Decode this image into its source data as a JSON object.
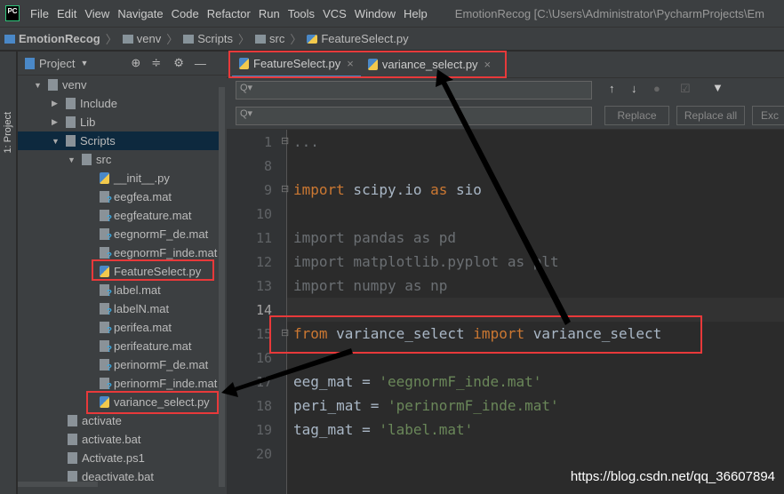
{
  "menubar": {
    "logo": "PC",
    "items": [
      "File",
      "Edit",
      "View",
      "Navigate",
      "Code",
      "Refactor",
      "Run",
      "Tools",
      "VCS",
      "Window",
      "Help"
    ],
    "window_title": "EmotionRecog [C:\\Users\\Administrator\\PycharmProjects\\Em"
  },
  "breadcrumb": [
    "EmotionRecog",
    "venv",
    "Scripts",
    "src",
    "FeatureSelect.py"
  ],
  "tool_strip": {
    "label": "1: Project"
  },
  "sidebar": {
    "title": "Project",
    "tree": [
      {
        "label": "venv",
        "depth": 1,
        "type": "folder",
        "expanded": true
      },
      {
        "label": "Include",
        "depth": 2,
        "type": "folder"
      },
      {
        "label": "Lib",
        "depth": 2,
        "type": "folder",
        "expanded": false
      },
      {
        "label": "Scripts",
        "depth": 2,
        "type": "folder",
        "expanded": true,
        "selected": true
      },
      {
        "label": "src",
        "depth": 3,
        "type": "folder",
        "expanded": true
      },
      {
        "label": "__init__.py",
        "depth": 4,
        "type": "py"
      },
      {
        "label": "eegfea.mat",
        "depth": 4,
        "type": "mat"
      },
      {
        "label": "eegfeature.mat",
        "depth": 4,
        "type": "mat"
      },
      {
        "label": "eegnormF_de.mat",
        "depth": 4,
        "type": "mat"
      },
      {
        "label": "eegnormF_inde.mat",
        "depth": 4,
        "type": "mat"
      },
      {
        "label": "FeatureSelect.py",
        "depth": 4,
        "type": "py"
      },
      {
        "label": "label.mat",
        "depth": 4,
        "type": "mat"
      },
      {
        "label": "labelN.mat",
        "depth": 4,
        "type": "mat"
      },
      {
        "label": "perifea.mat",
        "depth": 4,
        "type": "mat"
      },
      {
        "label": "perifeature.mat",
        "depth": 4,
        "type": "mat"
      },
      {
        "label": "perinormF_de.mat",
        "depth": 4,
        "type": "mat"
      },
      {
        "label": "perinormF_inde.mat",
        "depth": 4,
        "type": "mat"
      },
      {
        "label": "variance_select.py",
        "depth": 4,
        "type": "py"
      },
      {
        "label": "activate",
        "depth": 3,
        "type": "file"
      },
      {
        "label": "activate.bat",
        "depth": 3,
        "type": "file"
      },
      {
        "label": "Activate.ps1",
        "depth": 3,
        "type": "file"
      },
      {
        "label": "deactivate.bat",
        "depth": 3,
        "type": "file"
      }
    ]
  },
  "tabs": [
    {
      "label": "FeatureSelect.py",
      "active": true
    },
    {
      "label": "variance_select.py",
      "active": false
    }
  ],
  "find": {
    "replace": "Replace",
    "replace_all": "Replace all",
    "exclude": "Exc"
  },
  "editor": {
    "current_line": "14",
    "lines": [
      {
        "n": "1",
        "code": [
          {
            "t": "...",
            "c": "dim"
          }
        ]
      },
      {
        "n": "8",
        "code": []
      },
      {
        "n": "9",
        "code": [
          {
            "t": "import",
            "c": "kw"
          },
          {
            "t": " scipy.io ",
            "c": ""
          },
          {
            "t": "as",
            "c": "kw"
          },
          {
            "t": " sio",
            "c": ""
          }
        ]
      },
      {
        "n": "10",
        "code": []
      },
      {
        "n": "11",
        "code": [
          {
            "t": "import pandas as pd",
            "c": "dim"
          }
        ]
      },
      {
        "n": "12",
        "code": [
          {
            "t": "import matplotlib.pyplot as plt",
            "c": "dim"
          }
        ]
      },
      {
        "n": "13",
        "code": [
          {
            "t": "import numpy as np",
            "c": "dim"
          }
        ]
      },
      {
        "n": "14",
        "code": []
      },
      {
        "n": "15",
        "code": [
          {
            "t": "from",
            "c": "kw"
          },
          {
            "t": " variance_select ",
            "c": ""
          },
          {
            "t": "import",
            "c": "kw"
          },
          {
            "t": " variance_select",
            "c": ""
          }
        ]
      },
      {
        "n": "16",
        "code": []
      },
      {
        "n": "17",
        "code": [
          {
            "t": "eeg_mat = ",
            "c": ""
          },
          {
            "t": "'eegnormF_inde.mat'",
            "c": "st"
          }
        ]
      },
      {
        "n": "18",
        "code": [
          {
            "t": "peri_mat = ",
            "c": ""
          },
          {
            "t": "'perinormF_inde.mat'",
            "c": "st"
          }
        ]
      },
      {
        "n": "19",
        "code": [
          {
            "t": "tag_mat = ",
            "c": ""
          },
          {
            "t": "'label.mat'",
            "c": "st"
          }
        ]
      },
      {
        "n": "20",
        "code": []
      }
    ]
  },
  "watermark": "https://blog.csdn.net/qq_36607894",
  "colors": {
    "annotation": "#e8393a",
    "keyword": "#cc7832",
    "string": "#6a8759"
  }
}
